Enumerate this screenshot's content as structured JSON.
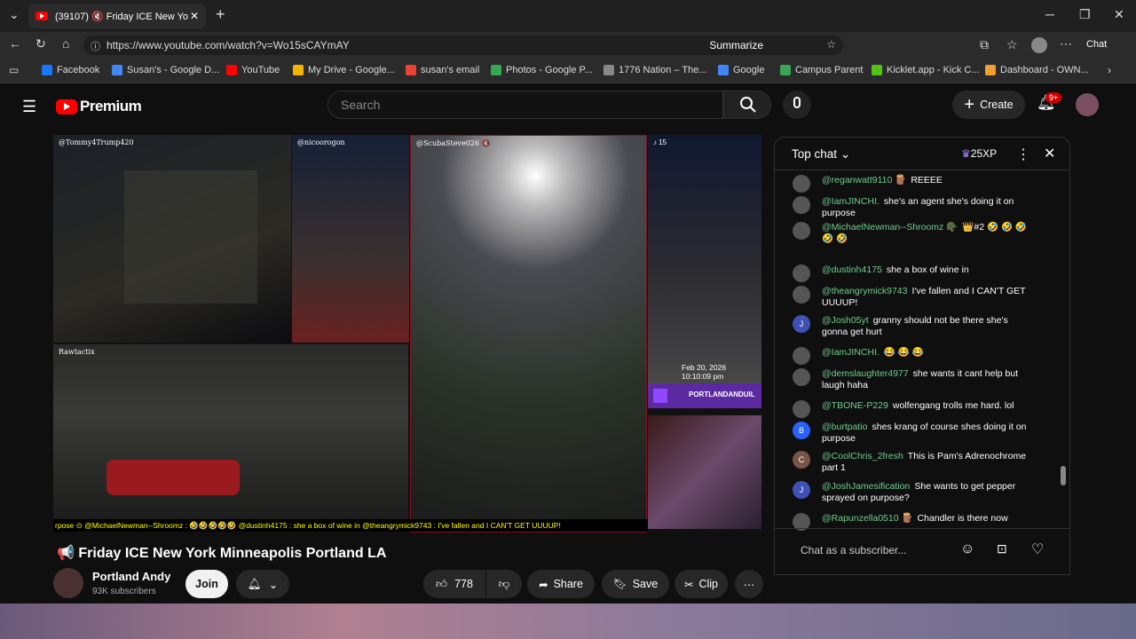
{
  "browser": {
    "tab_title": "(39107) 🔇 Friday ICE New Yo",
    "url": "https://www.youtube.com/watch?v=Wo15sCAYmAY",
    "summarize": "Summarize",
    "chat": "Chat"
  },
  "bookmarks": [
    "Facebook",
    "Susan's - Google D...",
    "YouTube",
    "My Drive - Google...",
    "susan's email",
    "Photos - Google P...",
    "1776 Nation – The...",
    "Google",
    "Campus Parent",
    "Kicklet.app - Kick C...",
    "Dashboard - OWN..."
  ],
  "yt": {
    "logo": "Premium",
    "search_placeholder": "Search",
    "create": "Create",
    "notif_badge": "9+"
  },
  "video": {
    "panes": [
      "@Tommy4Trump420",
      "@nicoorogon",
      "@ScubaSteve026 🔇",
      "♪ 15",
      "Rawtactix"
    ],
    "stamp_date": "Feb 20, 2026",
    "stamp_time": "10:10:09 pm",
    "twitch_label": "PORTLANDANDUIL",
    "ticker": "rpose  ⊙ @MichaelNewman--Shroomz : 🤣🤣🤣🤣🤣   @dustinh4175 : she a box of wine in   @theangrymick9743 : I've fallen and I CAN'T GET UUUUP!"
  },
  "title": "📢 Friday ICE New York Minneapolis Portland LA",
  "channel": {
    "name": "Portland Andy",
    "subs": "93K subscribers",
    "join": "Join"
  },
  "actions": {
    "likes": "778",
    "share": "Share",
    "save": "Save",
    "clip": "Clip"
  },
  "chat": {
    "header": "Top chat",
    "xp": "25XP",
    "input_placeholder": "Chat as a subscriber...",
    "messages": [
      {
        "user": "@reganwatt9110 🪵",
        "text": "REEEE",
        "av": ""
      },
      {
        "user": "@IamJINCHI.",
        "text": "she's an agent she's doing it on purpose",
        "av": ""
      },
      {
        "user": "@MichaelNewman--Shroomz 🪖",
        "text": "👑#2  🤣 🤣 🤣 🤣 🤣",
        "av": ""
      },
      {
        "user": "@dustinh4175",
        "text": "she a box of wine in",
        "av": ""
      },
      {
        "user": "@theangrymick9743",
        "text": "I've fallen and I CAN'T GET UUUUP!",
        "av": ""
      },
      {
        "user": "@Josh05yt",
        "text": "granny should not be there she's gonna get hurt",
        "av": "J"
      },
      {
        "user": "@IamJINCHI.",
        "text": "😂 😂 😂",
        "av": ""
      },
      {
        "user": "@demslaughter4977",
        "text": "she wants it cant help but laugh haha",
        "av": ""
      },
      {
        "user": "@TBONE-P229",
        "text": "wolfengang trolls me hard. lol",
        "av": ""
      },
      {
        "user": "@burtpatio",
        "text": "shes krang of course shes doing it on purpose",
        "av": "B"
      },
      {
        "user": "@CoolChris_2fresh",
        "text": "This is Pam's Adrenochrome part 1",
        "av": "C"
      },
      {
        "user": "@JoshJamesification",
        "text": "She wants to get pepper sprayed on purpose?",
        "av": "J"
      },
      {
        "user": "@Rapunzella0510 🪵",
        "text": "Chandler is there now",
        "av": ""
      }
    ]
  }
}
